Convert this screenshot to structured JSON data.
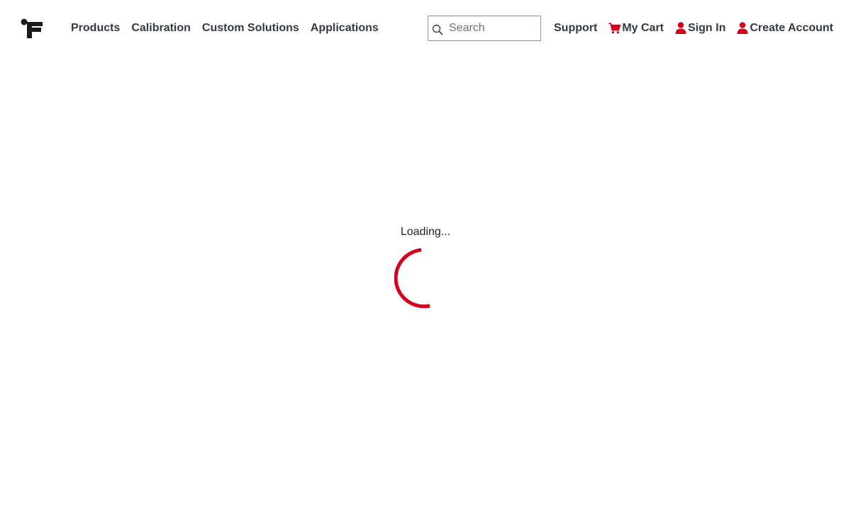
{
  "brand": {
    "logo_icon": "brand-logo-icon"
  },
  "nav": {
    "items": [
      {
        "label": "Products"
      },
      {
        "label": "Calibration"
      },
      {
        "label": "Custom Solutions"
      },
      {
        "label": "Applications"
      }
    ]
  },
  "search": {
    "placeholder": "Search",
    "value": "",
    "icon": "search-icon"
  },
  "utility": {
    "support_label": "Support",
    "cart_label": "My Cart",
    "cart_icon": "cart-icon",
    "signin_label": "Sign In",
    "signin_icon": "user-icon",
    "create_account_label": "Create Account",
    "create_account_icon": "user-icon"
  },
  "main": {
    "loading_text": "Loading..."
  },
  "colors": {
    "accent": "#d6001c",
    "text": "#333a44",
    "background": "#ffffff"
  }
}
